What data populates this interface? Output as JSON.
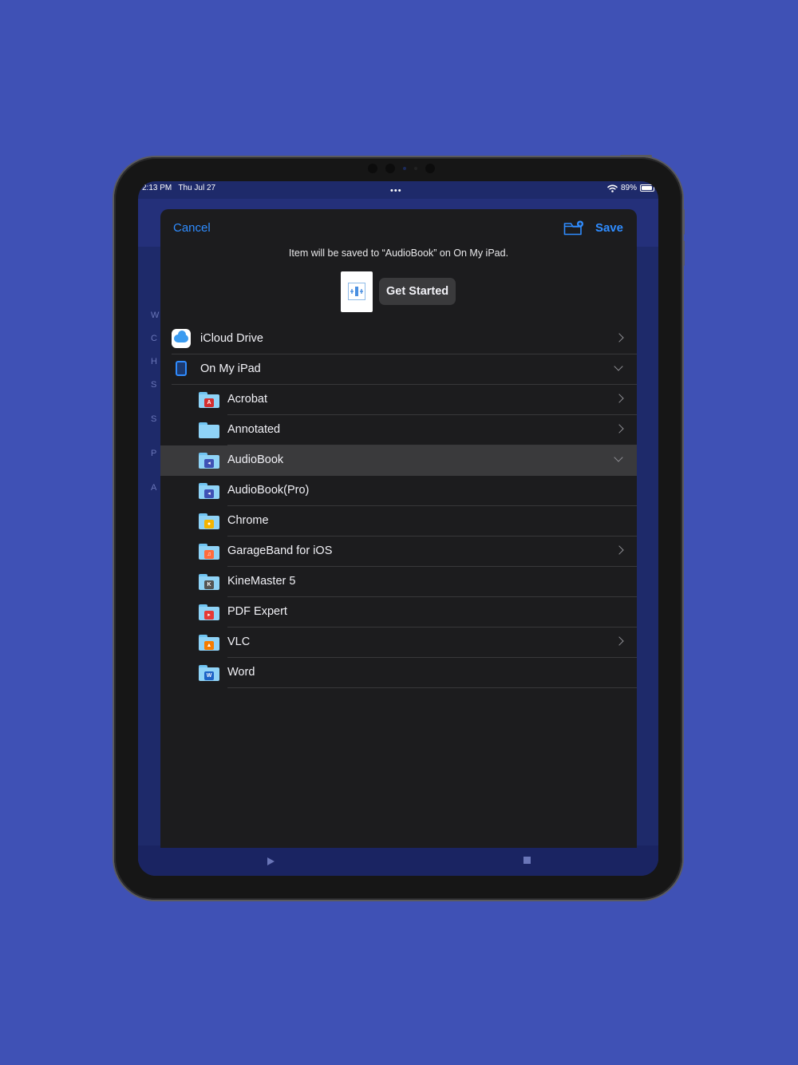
{
  "status_bar": {
    "time": "2:13 PM",
    "date": "Thu Jul 27",
    "multitask_dots": "•••",
    "battery_percent": "89%"
  },
  "sheet": {
    "cancel_label": "Cancel",
    "save_label": "Save",
    "save_message": "Item will be saved to “AudioBook” on On My iPad.",
    "filename": "Get Started"
  },
  "locations": [
    {
      "label": "iCloud Drive",
      "icon": "icloud-icon",
      "level": 0,
      "disclosure": "right"
    },
    {
      "label": "On My iPad",
      "icon": "ipad-icon",
      "level": 0,
      "disclosure": "down"
    },
    {
      "label": "Acrobat",
      "icon": "acrobat-folder-icon",
      "level": 1,
      "disclosure": "right",
      "badge_color": "#d32f2f",
      "badge_glyph": "A"
    },
    {
      "label": "Annotated",
      "icon": "folder-icon",
      "level": 1,
      "disclosure": "right",
      "badge_color": "",
      "badge_glyph": ""
    },
    {
      "label": "AudioBook",
      "icon": "audiobook-folder-icon",
      "level": 1,
      "disclosure": "down",
      "selected": true,
      "badge_color": "#3f51b5",
      "badge_glyph": "◂"
    },
    {
      "label": "AudioBook(Pro)",
      "icon": "audiobook-pro-folder-icon",
      "level": 1,
      "disclosure": "none",
      "badge_color": "#3f51b5",
      "badge_glyph": "◂"
    },
    {
      "label": "Chrome",
      "icon": "chrome-folder-icon",
      "level": 1,
      "disclosure": "none",
      "badge_color": "#f4b400",
      "badge_glyph": "●"
    },
    {
      "label": "GarageBand for iOS",
      "icon": "garageband-folder-icon",
      "level": 1,
      "disclosure": "right",
      "badge_color": "#ff6b3d",
      "badge_glyph": "♫"
    },
    {
      "label": "KineMaster 5",
      "icon": "kinemaster-folder-icon",
      "level": 1,
      "disclosure": "none",
      "badge_color": "#555555",
      "badge_glyph": "K"
    },
    {
      "label": "PDF Expert",
      "icon": "pdfexpert-folder-icon",
      "level": 1,
      "disclosure": "none",
      "badge_color": "#e53935",
      "badge_glyph": "▸"
    },
    {
      "label": "VLC",
      "icon": "vlc-folder-icon",
      "level": 1,
      "disclosure": "right",
      "badge_color": "#f57c00",
      "badge_glyph": "▲"
    },
    {
      "label": "Word",
      "icon": "word-folder-icon",
      "level": 1,
      "disclosure": "none",
      "badge_color": "#1e63c6",
      "badge_glyph": "W"
    }
  ]
}
